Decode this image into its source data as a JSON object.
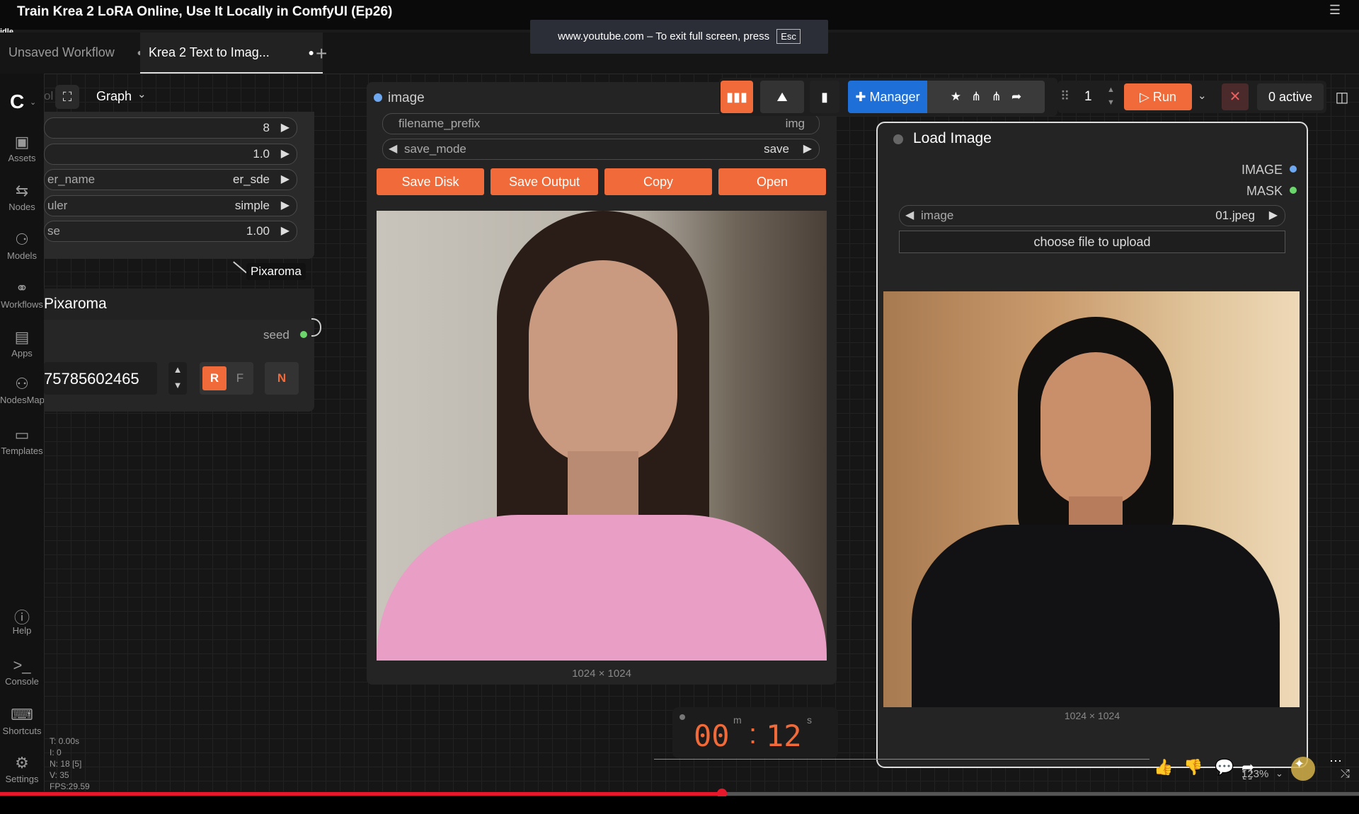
{
  "video": {
    "title": "Train Krea 2 LoRA Online, Use It Locally in ComfyUI (Ep26)",
    "status": "idle"
  },
  "fullscreen_banner": {
    "text": "www.youtube.com – To exit full screen, press",
    "key": "Esc"
  },
  "tabs": [
    {
      "label": "Unsaved Workflow",
      "dot": "●"
    },
    {
      "label": "Krea 2 Text to Imag...",
      "dot": "●"
    }
  ],
  "tab_add": "+",
  "sidebar": {
    "items": [
      {
        "label": "Assets",
        "icon": "image-icon"
      },
      {
        "label": "Nodes",
        "icon": "nodes-icon"
      },
      {
        "label": "Models",
        "icon": "models-icon"
      },
      {
        "label": "Workflows",
        "icon": "workflows-icon"
      },
      {
        "label": "Apps",
        "icon": "apps-icon"
      },
      {
        "label": "NodesMap",
        "icon": "nodesmap-icon"
      },
      {
        "label": "Templates",
        "icon": "templates-icon"
      },
      {
        "label": "Help",
        "icon": "help-icon"
      },
      {
        "label": "Console",
        "icon": "console-icon"
      },
      {
        "label": "Shortcuts",
        "icon": "keyboard-icon"
      },
      {
        "label": "Settings",
        "icon": "gear-icon"
      }
    ]
  },
  "graph_toggle": {
    "label": "Graph",
    "partial": "ol"
  },
  "sampler_node": {
    "widgets": [
      {
        "label": "",
        "value": "8"
      },
      {
        "label": "",
        "value": "1.0"
      },
      {
        "label": "er_name",
        "value": "er_sde"
      },
      {
        "label": "uler",
        "value": "simple"
      },
      {
        "label": "se",
        "value": "1.00"
      }
    ]
  },
  "pixaroma_tag": "Pixaroma",
  "seed_node": {
    "title": "Pixaroma",
    "output_label": "seed",
    "seed_value": "75785602465",
    "buttons": [
      "R",
      "F",
      "N"
    ]
  },
  "save_node": {
    "input_label": "image",
    "filename_prefix": {
      "label": "filename_prefix",
      "value": "img"
    },
    "save_mode": {
      "label": "save_mode",
      "value": "save"
    },
    "buttons": [
      "Save Disk",
      "Save Output",
      "Copy",
      "Open"
    ],
    "image_size": "1024 × 1024"
  },
  "load_node": {
    "title": "Load Image",
    "outputs": [
      "IMAGE",
      "MASK"
    ],
    "image_widget": {
      "label": "image",
      "value": "01.jpeg"
    },
    "upload_label": "choose file to upload",
    "image_size": "1024 × 1024"
  },
  "toolbar": {
    "manager_label": "Manager",
    "queue_count": "1",
    "run_label": "Run",
    "active_label": "0 active"
  },
  "timer": {
    "minutes": "00",
    "seconds": "12",
    "m_unit": "m",
    "s_unit": "s",
    "sep": ":"
  },
  "perf": {
    "lines": [
      "T: 0.00s",
      "I: 0",
      "N: 18 [5]",
      "V: 35",
      "FPS:29.59"
    ]
  },
  "zoom": "123%",
  "video_progress": 0.531,
  "colors": {
    "accent": "#f06a3a",
    "progress": "#e8182c",
    "manager": "#1e6fd8"
  }
}
